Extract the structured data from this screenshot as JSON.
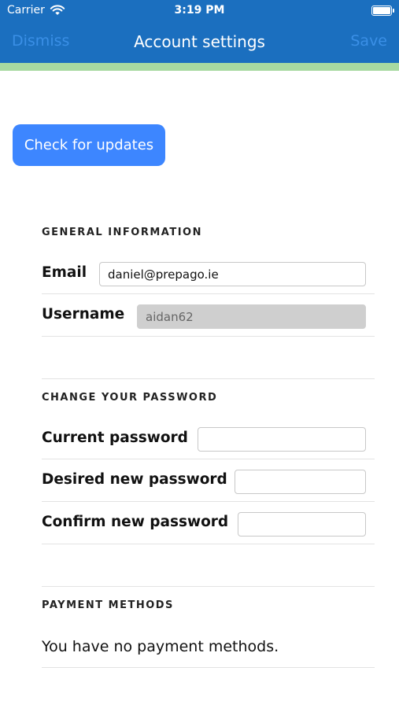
{
  "status_bar": {
    "carrier": "Carrier",
    "time": "3:19 PM"
  },
  "nav": {
    "left": "Dismiss",
    "title": "Account settings",
    "right": "Save"
  },
  "colors": {
    "header": "#1b6fbf",
    "accent_strip": "#a8d9a1",
    "button": "#3d86ff",
    "nav_action": "#3a8fe6"
  },
  "icons": {
    "wifi": "wifi-icon",
    "battery": "battery-icon"
  },
  "update_button": "Check for updates",
  "general": {
    "title": "GENERAL INFORMATION",
    "email_label": "Email",
    "email_value": "daniel@prepago.ie",
    "username_label": "Username",
    "username_value": "aidan62"
  },
  "password": {
    "title": "CHANGE YOUR PASSWORD",
    "current_label": "Current password",
    "desired_label": "Desired new password",
    "confirm_label": "Confirm new password"
  },
  "payment": {
    "title": "PAYMENT METHODS",
    "empty_text": "You have no payment methods."
  }
}
